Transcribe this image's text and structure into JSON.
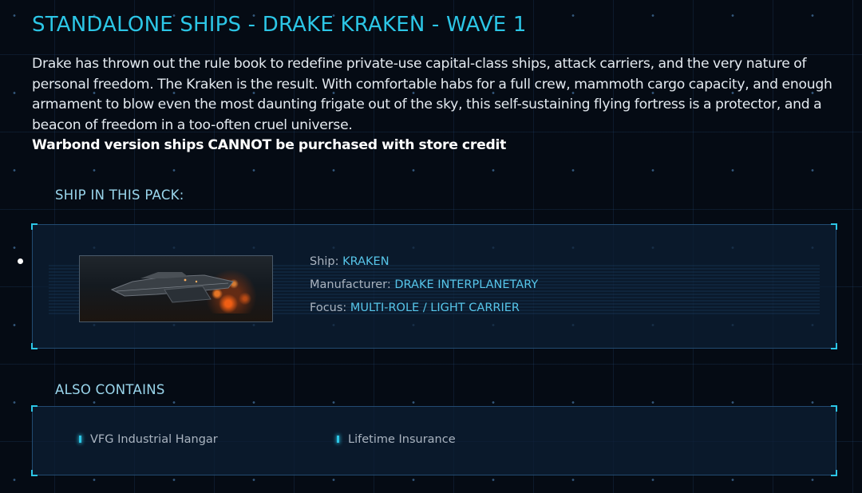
{
  "header": {
    "title": "STANDALONE SHIPS - DRAKE KRAKEN - WAVE 1"
  },
  "description": {
    "body": "Drake has thrown out the rule book to redefine private-use capital-class ships, attack carriers, and the very nature of personal freedom. The Kraken is the result. With comfortable habs for a full crew, mammoth cargo capacity, and enough armament to blow even the most daunting frigate out of the sky, this self-sustaining flying fortress is a protector, and a beacon of freedom in a too-often cruel universe.",
    "warning": "Warbond version ships CANNOT be purchased with store credit"
  },
  "ship_section": {
    "heading": "SHIP IN THIS PACK:",
    "ship": {
      "ship_label": "Ship:",
      "ship_value": "KRAKEN",
      "manufacturer_label": "Manufacturer:",
      "manufacturer_value": "DRAKE INTERPLANETARY",
      "focus_label": "Focus:",
      "focus_value": "MULTI-ROLE / LIGHT CARRIER"
    }
  },
  "also_contains": {
    "heading": "ALSO CONTAINS",
    "items": [
      {
        "label": "VFG Industrial Hangar"
      },
      {
        "label": "Lifetime Insurance"
      }
    ]
  },
  "colors": {
    "accent": "#2cc6e6",
    "value_text": "#57c6ea",
    "background": "#050b14",
    "panel": "#0c1e34"
  }
}
